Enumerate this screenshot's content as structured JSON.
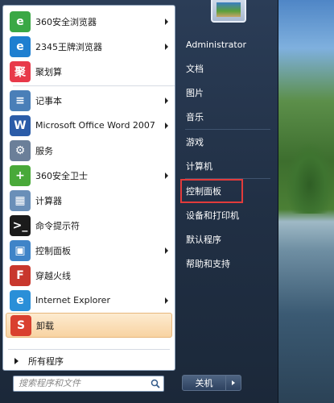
{
  "programs": [
    {
      "label": "360安全浏览器",
      "icon": "360-browser-icon",
      "color": "#3aa845",
      "glyph": "e",
      "arrow": true
    },
    {
      "label": "2345王牌浏览器",
      "icon": "2345-browser-icon",
      "color": "#1e7fd0",
      "glyph": "e",
      "arrow": true
    },
    {
      "label": "聚划算",
      "icon": "juhuasuan-icon",
      "color": "#e8394a",
      "glyph": "聚",
      "arrow": false
    },
    {
      "label": "记事本",
      "icon": "notepad-icon",
      "color": "#4a7fb8",
      "glyph": "≡",
      "arrow": true
    },
    {
      "label": "Microsoft Office Word 2007",
      "icon": "word-icon",
      "color": "#2b5ca8",
      "glyph": "W",
      "arrow": true
    },
    {
      "label": "服务",
      "icon": "services-icon",
      "color": "#6b7f99",
      "glyph": "⚙",
      "arrow": false
    },
    {
      "label": "360安全卫士",
      "icon": "360-safeguard-icon",
      "color": "#49a939",
      "glyph": "+",
      "arrow": true
    },
    {
      "label": "计算器",
      "icon": "calculator-icon",
      "color": "#6a8fb8",
      "glyph": "▦",
      "arrow": false
    },
    {
      "label": "命令提示符",
      "icon": "cmd-icon",
      "color": "#1b1b1b",
      "glyph": ">_",
      "arrow": false
    },
    {
      "label": "控制面板",
      "icon": "control-panel-icon",
      "color": "#3f84c8",
      "glyph": "▣",
      "arrow": true
    },
    {
      "label": "穿越火线",
      "icon": "crossfire-icon",
      "color": "#c8372d",
      "glyph": "F",
      "arrow": false
    },
    {
      "label": "Internet Explorer",
      "icon": "ie-icon",
      "color": "#2a8fd8",
      "glyph": "e",
      "arrow": true
    },
    {
      "label": "卸载",
      "icon": "uninstall-icon",
      "color": "#d9402f",
      "glyph": "S",
      "arrow": false,
      "highlight": true
    }
  ],
  "all_programs": "所有程序",
  "search_placeholder": "搜索程序和文件",
  "right": {
    "user": "Administrator",
    "items": [
      "文档",
      "图片",
      "音乐",
      "游戏",
      "计算机",
      "控制面板",
      "设备和打印机",
      "默认程序",
      "帮助和支持"
    ]
  },
  "shutdown": "关机"
}
